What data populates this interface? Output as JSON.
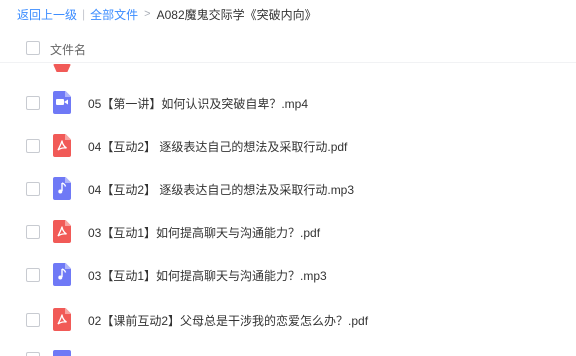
{
  "breadcrumb": {
    "back": "返回上一级",
    "separator": "|",
    "all_files": "全部文件",
    "arrow": ">",
    "current": "A082魔鬼交际学《突破内向》"
  },
  "header": {
    "filename_column": "文件名"
  },
  "files": [
    {
      "name": "05【第一讲】如何认识及突破自卑？.mp4",
      "type": "video",
      "icon": "video-file-icon"
    },
    {
      "name": "04【互动2】 逐级表达自己的想法及采取行动.pdf",
      "type": "pdf",
      "icon": "pdf-file-icon"
    },
    {
      "name": "04【互动2】 逐级表达自己的想法及采取行动.mp3",
      "type": "audio",
      "icon": "audio-file-icon"
    },
    {
      "name": "03【互动1】如何提高聊天与沟通能力？.pdf",
      "type": "pdf",
      "icon": "pdf-file-icon"
    },
    {
      "name": "03【互动1】如何提高聊天与沟通能力？.mp3",
      "type": "audio",
      "icon": "audio-file-icon"
    },
    {
      "name": "02【课前互动2】父母总是干涉我的恋爱怎么办？.pdf",
      "type": "pdf",
      "icon": "pdf-file-icon"
    }
  ],
  "colors": {
    "link": "#3b8cff",
    "pdf": "#f15a57",
    "media": "#6f79f6"
  }
}
